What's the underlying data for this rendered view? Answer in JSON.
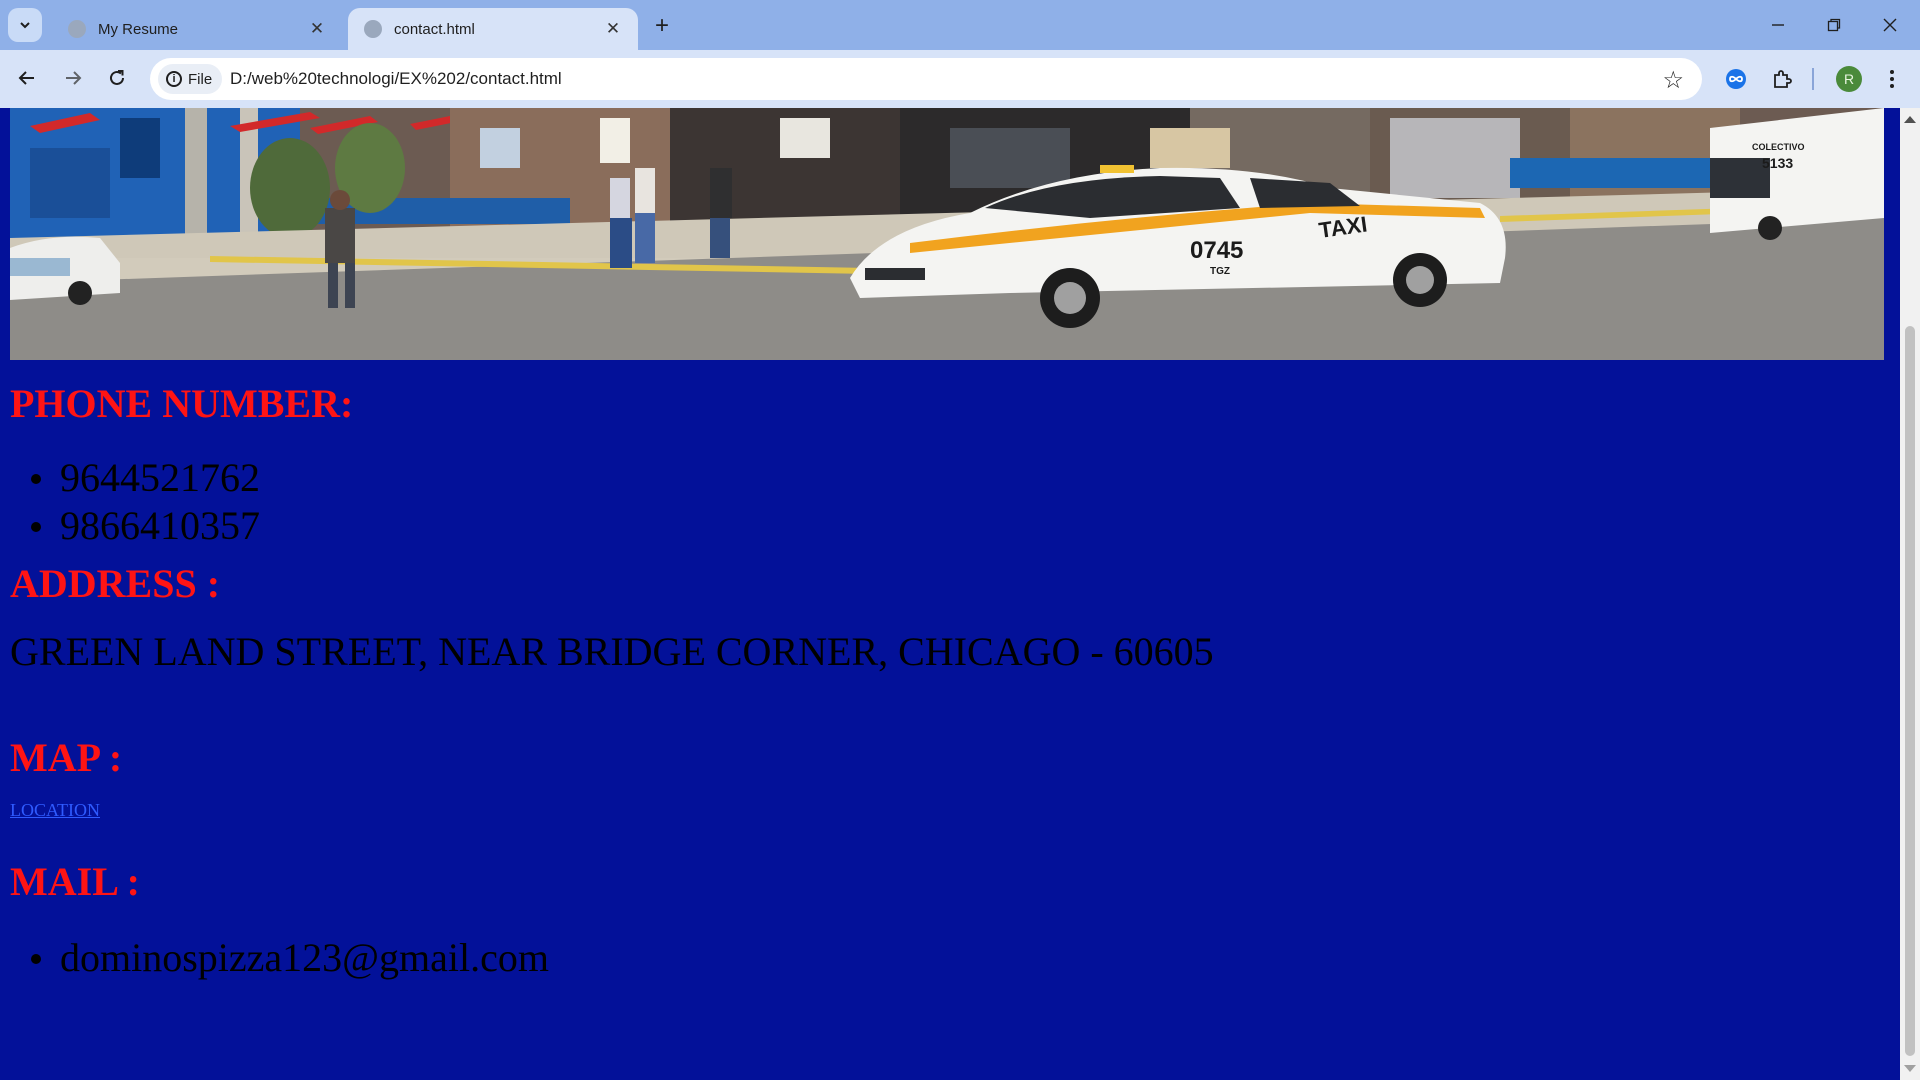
{
  "browser": {
    "tabs": [
      {
        "title": "My Resume",
        "active": false
      },
      {
        "title": "contact.html",
        "active": true
      }
    ],
    "address_chip": "File",
    "url": "D:/web%20technologi/EX%202/contact.html",
    "profile_initial": "R",
    "icons": [
      "tab-search-icon",
      "close-icon",
      "new-tab-icon",
      "minimize-icon",
      "restore-icon",
      "window-close-icon",
      "back-icon",
      "forward-icon",
      "reload-icon",
      "info-icon",
      "star-icon",
      "extension-infinity-icon",
      "extensions-puzzle-icon",
      "menu-kebab-icon"
    ]
  },
  "page": {
    "background_color": "#031199",
    "heading_color": "#ff1414",
    "hero_image": "street scene with a white and orange TAXI car",
    "hero_signs": {
      "taxi_text": "TAXI",
      "taxi_number": "0745",
      "taxi_plate": "TGZ",
      "van_text": "COLECTIVO",
      "van_number": "5133"
    },
    "phone": {
      "heading": "PHONE NUMBER:",
      "numbers": [
        "9644521762",
        "9866410357"
      ]
    },
    "address": {
      "heading": "ADDRESS :",
      "text": "GREEN LAND STREET, NEAR BRIDGE CORNER, CHICAGO - 60605"
    },
    "map": {
      "heading": "MAP :",
      "link_text": "LOCATION"
    },
    "mail": {
      "heading": "MAIL :",
      "emails": [
        "dominospizza123@gmail.com"
      ]
    }
  }
}
